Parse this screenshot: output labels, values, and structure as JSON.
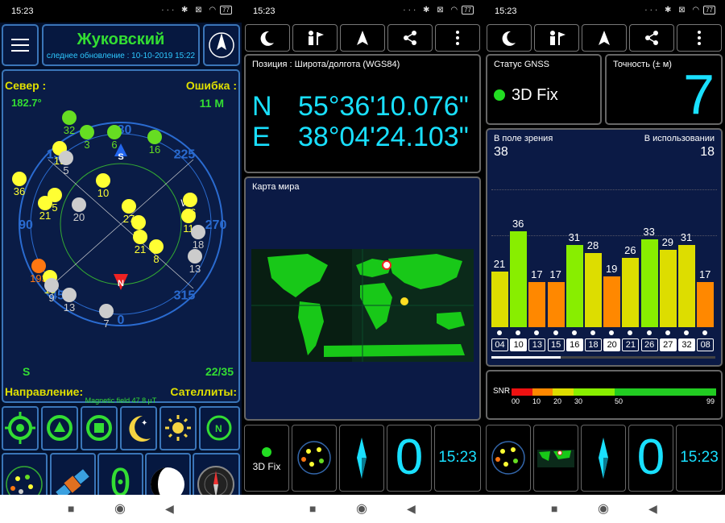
{
  "status_bar": {
    "time": "15:23",
    "battery": "77",
    "icons": "··· ✱ ⊠ ◠"
  },
  "p1": {
    "city": "Жуковский",
    "last_update": "следнее обновление : 10-10-2019 15:22",
    "north_label": "Север :",
    "north_value": "182.7°",
    "error_label": "Ошибка :",
    "error_value": "11 M",
    "south_letter": "S",
    "sat_count": "22/35",
    "direction_label": "Направление:",
    "satellites_label": "Сателлиты:",
    "magnetic": "Magnetic field 47.8 µT",
    "compass": {
      "degrees": [
        "180",
        "135",
        "225",
        "90",
        "270",
        "45",
        "315",
        "0"
      ],
      "letters": {
        "S": "S",
        "N": "N",
        "W": "W"
      },
      "sats": [
        {
          "id": "32",
          "c": "#66dd22"
        },
        {
          "id": "3",
          "c": "#66dd22"
        },
        {
          "id": "6",
          "c": "#66dd22"
        },
        {
          "id": "16",
          "c": "#66dd22"
        },
        {
          "id": "19",
          "c": "#ffff33"
        },
        {
          "id": "5",
          "c": "#cccccc"
        },
        {
          "id": "36",
          "c": "#ffff33"
        },
        {
          "id": "10",
          "c": "#ffff33"
        },
        {
          "id": "21",
          "c": "#ffff33"
        },
        {
          "id": "5",
          "c": "#ffff33"
        },
        {
          "id": "20",
          "c": "#cccccc"
        },
        {
          "id": "27",
          "c": "#ffff33"
        },
        {
          "id": "15",
          "c": "#ffff33"
        },
        {
          "id": "21",
          "c": "#ffff33"
        },
        {
          "id": "8",
          "c": "#ffff33"
        },
        {
          "id": "26",
          "c": "#ffff33"
        },
        {
          "id": "11",
          "c": "#ffff33"
        },
        {
          "id": "18",
          "c": "#cccccc"
        },
        {
          "id": "13",
          "c": "#cccccc"
        },
        {
          "id": "193",
          "c": "#ff7711"
        },
        {
          "id": "15",
          "c": "#ffff33"
        },
        {
          "id": "9",
          "c": "#cccccc"
        },
        {
          "id": "13",
          "c": "#cccccc"
        },
        {
          "id": "7",
          "c": "#cccccc"
        }
      ]
    },
    "tile_digit": "0"
  },
  "p2": {
    "position_label": "Позиция : Широта/долгота (WGS84)",
    "lat_hem": "N",
    "lat": "55°36'10.076\"",
    "lon_hem": "E",
    "lon": "38°04'24.103\"",
    "map_label": "Карта мира",
    "fix": "3D Fix",
    "accuracy_big": "0",
    "clock": "15:23"
  },
  "p3": {
    "gnss_label": "Статус GNSS",
    "fix": "3D Fix",
    "accuracy_label": "Точность (± м)",
    "accuracy_value": "7",
    "in_view_label": "В поле зрения",
    "in_view": "38",
    "in_use_label": "В использовании",
    "in_use": "18",
    "snr_label": "SNR",
    "snr_ticks": [
      "00",
      "10",
      "20",
      "30",
      "50",
      "99"
    ],
    "accuracy_big": "0",
    "clock": "15:23"
  },
  "chart_data": {
    "type": "bar",
    "categories": [
      "04",
      "10",
      "13",
      "15",
      "16",
      "18",
      "20",
      "21",
      "26",
      "27",
      "32",
      "08"
    ],
    "values": [
      21,
      36,
      17,
      17,
      31,
      28,
      19,
      26,
      33,
      29,
      31,
      17
    ],
    "used": [
      false,
      true,
      false,
      false,
      true,
      false,
      true,
      false,
      false,
      true,
      true,
      false
    ],
    "colors": [
      "#dddd00",
      "#88ee00",
      "#ff8800",
      "#ff8800",
      "#88ee00",
      "#dddd00",
      "#ff8800",
      "#dddd00",
      "#88ee00",
      "#dddd00",
      "#dddd00",
      "#ff8800"
    ],
    "ylim": [
      0,
      50
    ]
  }
}
